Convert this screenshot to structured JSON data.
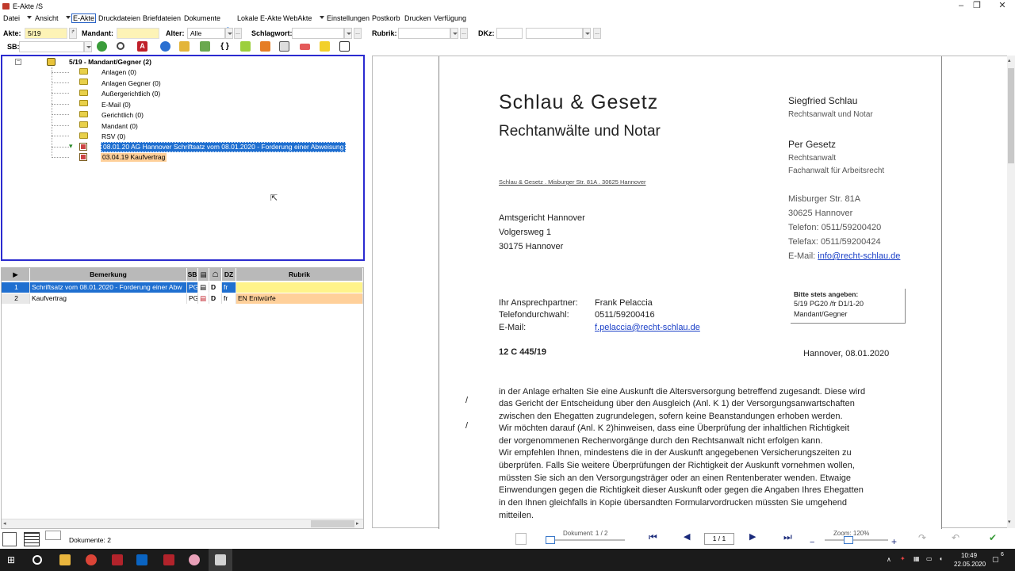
{
  "window": {
    "title": "E-Akte /S"
  },
  "menu": {
    "items": [
      "Datei",
      "Ansicht",
      "E-Akte",
      "Druckdateien",
      "Briefdateien",
      "Dokumente",
      "Lokale E-Akte",
      "WebAkte",
      "Einstellungen",
      "Postkorb",
      "Drucken",
      "Verfügung"
    ],
    "active": "E-Akte"
  },
  "filters": {
    "akte_label": "Akte:",
    "akte_value": "5/19",
    "mandant_label": "Mandant:",
    "mandant_value": "",
    "alter_label": "Alter:",
    "alter_value": "Alle",
    "schlagwort_label": "Schlagwort:",
    "schlagwort_value": "",
    "rubrik_label": "Rubrik:",
    "rubrik_value": "",
    "dkz_label": "DKz:",
    "dkz_value": "",
    "dkz2_value": "",
    "sb_label": "SB:",
    "sb_value": ""
  },
  "toolbar": {
    "icons": [
      "refresh-icon",
      "search-icon",
      "pdf-icon",
      "info-icon",
      "folder-open-icon",
      "export-icon",
      "brackets-icon",
      "add-icon",
      "edit-icon",
      "print-icon",
      "mail-icon",
      "note-icon",
      "list-icon"
    ]
  },
  "tree": {
    "root": "5/19 - Mandant/Gegner (2)",
    "folders": [
      "Anlagen (0)",
      "Anlagen Gegner (0)",
      "Außergerichtlich (0)",
      "E-Mail (0)",
      "Gerichtlich (0)",
      "Mandant (0)",
      "RSV (0)"
    ],
    "documents": [
      {
        "label": "08.01.20 AG Hannover Schriftsatz vom 08.01.2020 - Forderung einer Abweisung",
        "selected": true
      },
      {
        "label": "03.04.19 Kaufvertrag",
        "selected": false
      }
    ]
  },
  "list": {
    "headers": {
      "bemerkung": "Bemerkung",
      "sb": "SB",
      "dz": "DZ",
      "rubrik": "Rubrik"
    },
    "rows": [
      {
        "num": "1",
        "bemerkung": "Schriftsatz vom 08.01.2020 - Forderung einer Abw",
        "sb": "PG",
        "d": "D",
        "dz": "fr",
        "rubrik": ""
      },
      {
        "num": "2",
        "bemerkung": "Kaufvertrag",
        "sb": "PG",
        "d": "D",
        "dz": "fr",
        "rubrik": "EN Entwürfe"
      }
    ]
  },
  "letter": {
    "firm": "Schlau & Gesetz",
    "firm_sub": "Rechtanwälte und Notar",
    "partner1_name": "Siegfried Schlau",
    "partner1_title": "Rechtsanwalt und Notar",
    "partner2_name": "Per Gesetz",
    "partner2_title1": "Rechtsanwalt",
    "partner2_title2": "Fachanwalt für Arbeitsrecht",
    "sender_line": "Schlau & Gesetz . Misburger Str. 81A . 30625 Hannover",
    "addr_street": "Misburger Str. 81A",
    "addr_city": "30625 Hannover",
    "phone": "Telefon: 0511/59200420",
    "fax": "Telefax: 0511/59200424",
    "email_label": "E-Mail:",
    "email": "info@recht-schlau.de",
    "recipient1": "Amtsgericht Hannover",
    "recipient2": "Volgersweg 1",
    "recipient3": "30175 Hannover",
    "box_title": "Bitte stets angeben:",
    "box_line1": "5/19 PG20 /fr D1/1-20",
    "box_line2": "Mandant/Gegner",
    "contact_label": "Ihr Ansprechpartner:",
    "contact_name": "Frank Pelaccia",
    "direct_label": "Telefondurchwahl:",
    "direct_value": "0511/59200416",
    "mail_label": "E-Mail:",
    "mail_value": "f.pelaccia@recht-schlau.de",
    "case_no": "12 C 445/19",
    "date_line": "Hannover, 08.01.2020",
    "margin_mark": "/",
    "body": [
      "in der Anlage erhalten Sie eine Auskunft die Altersversorgung betreffend zugesandt. Diese wird",
      "das Gericht der Entscheidung über den Ausgleich (Anl. K 1) der Versorgungsanwartschaften",
      "zwischen den Ehegatten zugrundelegen, sofern keine Beanstandungen erhoben werden.",
      "Wir möchten darauf   (Anl. K 2)hinweisen, dass eine Überprüfung der inhaltlichen Richtigkeit",
      "der vorgenommenen Rechenvorgänge durch den Rechtsanwalt nicht erfolgen kann.",
      "Wir empfehlen Ihnen, mindestens die in der Auskunft angegebenen Versicherungszeiten zu",
      "überprüfen. Falls Sie weitere Überprüfungen der Richtigkeit der Auskunft vornehmen wollen,",
      "müssten Sie sich an den Versorgungsträger oder an einen Rentenberater wenden. Etwaige",
      "Einwendungen gegen die Richtigkeit dieser Auskunft oder gegen die Angaben Ihres Ehegatten",
      "in den Ihnen gleichfalls in Kopie übersandten Formularvordrucken müssten Sie umgehend",
      "mitteilen."
    ]
  },
  "status": {
    "documents_count": "Dokumente: 2",
    "document_pos": "Dokument: 1 / 2",
    "page": "1 / 1",
    "zoom": "Zoom: 120%",
    "zoom_minus": "−",
    "zoom_plus": "+",
    "document_progress": 0.5,
    "zoom_level": 1.2
  },
  "taskbar": {
    "time": "10:49",
    "date": "22.05.2020",
    "badge": "6"
  },
  "colors": {
    "accent": "#1f6fd0",
    "tree_border": "#2b2bd0",
    "row_yellow": "#fff38a",
    "row_orange": "#ffd09a",
    "header_gray": "#b9b9b9"
  }
}
